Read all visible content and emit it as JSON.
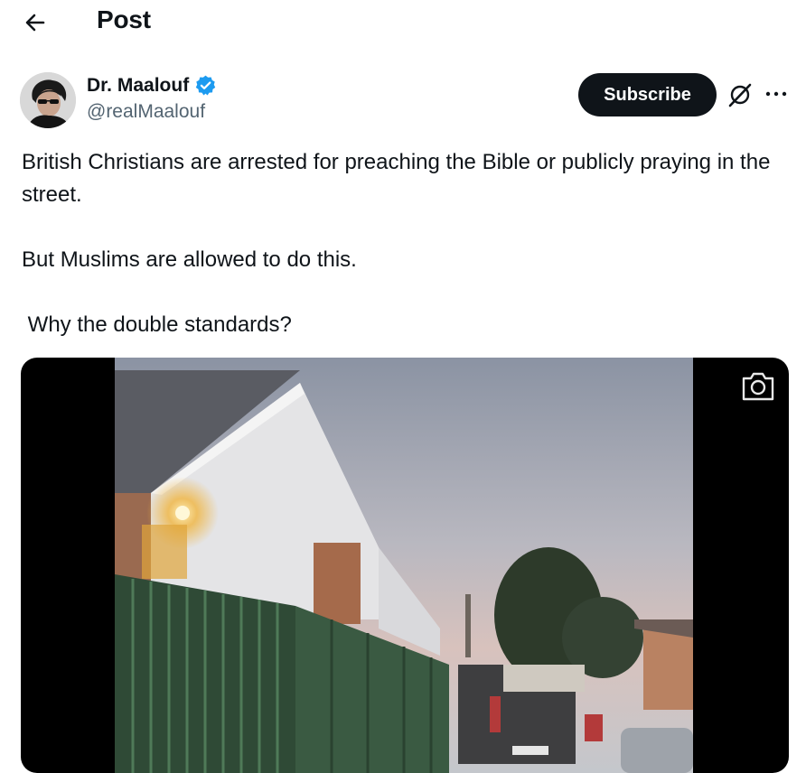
{
  "header": {
    "back_icon": "arrow-left-icon",
    "title": "Post"
  },
  "author": {
    "display_name": "Dr. Maalouf",
    "handle": "@realMaalouf",
    "verified_icon": "verified-badge-icon",
    "verified_color": "#1d9bf0"
  },
  "actions": {
    "subscribe_label": "Subscribe",
    "grok_icon": "grok-icon",
    "more_icon": "more-horizontal-icon"
  },
  "post": {
    "line1": "British Christians are arrested for preaching the Bible or publicly praying in the street.",
    "line2": "But Muslims are allowed to do this.",
    "line3": " Why the double standards?"
  },
  "media": {
    "type": "video",
    "camera_icon": "camera-icon"
  },
  "colors": {
    "text": "#0f1419",
    "secondary_text": "#536471",
    "button_bg": "#0f1419",
    "accent": "#1d9bf0"
  }
}
